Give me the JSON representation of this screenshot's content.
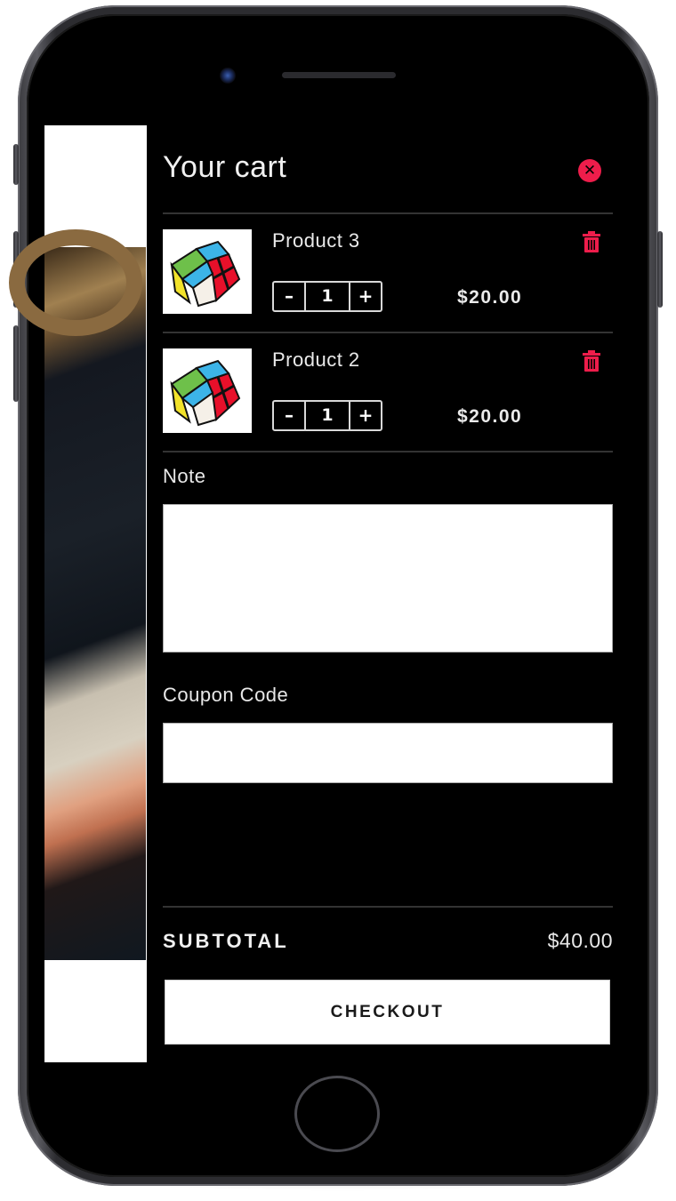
{
  "cart": {
    "title": "Your cart",
    "close_icon": "close-circle-icon",
    "items": [
      {
        "name": "Product 3",
        "quantity": "1",
        "price": "$20.00",
        "image": "rubiks-cube-thumbnail",
        "minus_label": "–",
        "plus_label": "+"
      },
      {
        "name": "Product 2",
        "quantity": "1",
        "price": "$20.00",
        "image": "rubiks-cube-thumbnail",
        "minus_label": "–",
        "plus_label": "+"
      }
    ],
    "note": {
      "label": "Note",
      "value": "",
      "placeholder": ""
    },
    "coupon": {
      "label": "Coupon Code",
      "value": "",
      "placeholder": ""
    },
    "subtotal": {
      "label": "SUBTOTAL",
      "value": "$40.00"
    },
    "checkout_label": "CHECKOUT"
  },
  "colors": {
    "accent": "#ee1d4b",
    "panel_bg": "#000000",
    "text": "#eaeaea"
  }
}
